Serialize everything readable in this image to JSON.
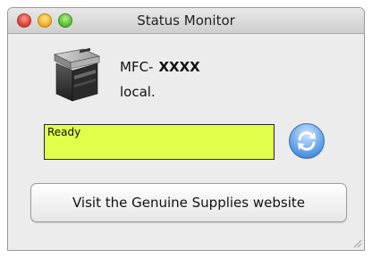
{
  "window": {
    "title": "Status Monitor",
    "controls": [
      "close",
      "minimize",
      "zoom"
    ]
  },
  "device": {
    "model_prefix": "MFC-",
    "model_name": "XXXX",
    "host": "local.",
    "icon": "printer-icon"
  },
  "status": {
    "text": "Ready",
    "color": "#e0ff4a"
  },
  "refresh": {
    "icon": "refresh-icon",
    "color": "#5a9ce8"
  },
  "supplies_button": {
    "label": "Visit the Genuine Supplies website"
  }
}
